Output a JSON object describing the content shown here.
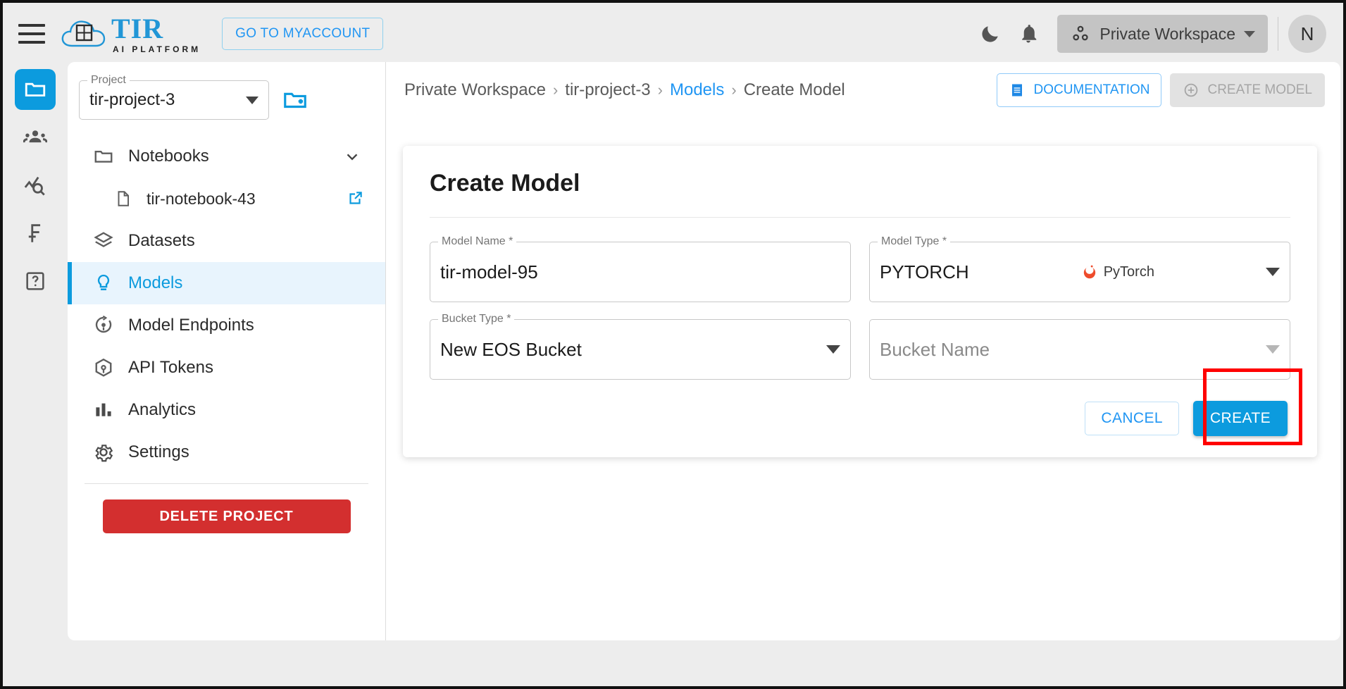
{
  "header": {
    "menu_icon": "hamburger-menu-icon",
    "brand_name": "TIR",
    "brand_tagline": "AI PLATFORM",
    "myaccount_label": "GO TO MYACCOUNT",
    "dark_mode_icon": "moon-icon",
    "notifications_icon": "bell-icon",
    "workspace_label": "Private Workspace",
    "workspace_icon": "workspace-dots-icon",
    "avatar_initial": "N"
  },
  "rail": {
    "items": [
      {
        "icon": "folder-icon",
        "name": "projects",
        "active": true
      },
      {
        "icon": "team-icon",
        "name": "team",
        "active": false
      },
      {
        "icon": "analytics-search-icon",
        "name": "monitoring",
        "active": false
      },
      {
        "icon": "billing-icon",
        "name": "billing",
        "active": false
      },
      {
        "icon": "help-icon",
        "name": "help",
        "active": false
      }
    ]
  },
  "sidebar": {
    "project_field": {
      "label": "Project",
      "value": "tir-project-3"
    },
    "new_project_icon": "new-folder-icon",
    "items": [
      {
        "label": "Notebooks",
        "icon": "folder-icon",
        "active": false,
        "child": false,
        "trailing": "chevron-down-icon"
      },
      {
        "label": "tir-notebook-43",
        "icon": "file-icon",
        "active": false,
        "child": true,
        "trailing": "open-in-new-icon"
      },
      {
        "label": "Datasets",
        "icon": "layers-icon",
        "active": false,
        "child": false,
        "trailing": ""
      },
      {
        "label": "Models",
        "icon": "lightbulb-icon",
        "active": true,
        "child": false,
        "trailing": ""
      },
      {
        "label": "Model Endpoints",
        "icon": "endpoint-icon",
        "active": false,
        "child": false,
        "trailing": ""
      },
      {
        "label": "API Tokens",
        "icon": "cube-icon",
        "active": false,
        "child": false,
        "trailing": ""
      },
      {
        "label": "Analytics",
        "icon": "bar-chart-icon",
        "active": false,
        "child": false,
        "trailing": ""
      },
      {
        "label": "Settings",
        "icon": "gear-icon",
        "active": false,
        "child": false,
        "trailing": ""
      }
    ],
    "delete_label": "DELETE PROJECT"
  },
  "breadcrumb": {
    "items": [
      {
        "label": "Private Workspace",
        "link": false
      },
      {
        "label": "tir-project-3",
        "link": false
      },
      {
        "label": "Models",
        "link": true
      },
      {
        "label": "Create Model",
        "link": false
      }
    ],
    "separator": "›"
  },
  "toolbar": {
    "documentation_label": "DOCUMENTATION",
    "documentation_icon": "document-icon",
    "create_model_label": "CREATE MODEL",
    "create_model_icon": "plus-circle-icon",
    "create_model_disabled": true
  },
  "form": {
    "title": "Create Model",
    "model_name": {
      "label": "Model Name *",
      "value": "tir-model-95",
      "placeholder": "Model Name"
    },
    "model_type": {
      "label": "Model Type *",
      "value": "PYTORCH",
      "badge_text": "PyTorch",
      "badge_icon": "pytorch-logo-icon"
    },
    "bucket_type": {
      "label": "Bucket Type *",
      "value": "New EOS Bucket"
    },
    "bucket_name": {
      "label": "",
      "value": "",
      "placeholder": "Bucket Name"
    },
    "cancel_label": "CANCEL",
    "create_label": "CREATE"
  },
  "annotation": {
    "highlight_target": "create-button",
    "color": "#ff0000"
  },
  "colors": {
    "accent": "#0c9bde",
    "link": "#2196f3",
    "danger": "#d32f2f",
    "pytorch": "#ee4c2c"
  }
}
